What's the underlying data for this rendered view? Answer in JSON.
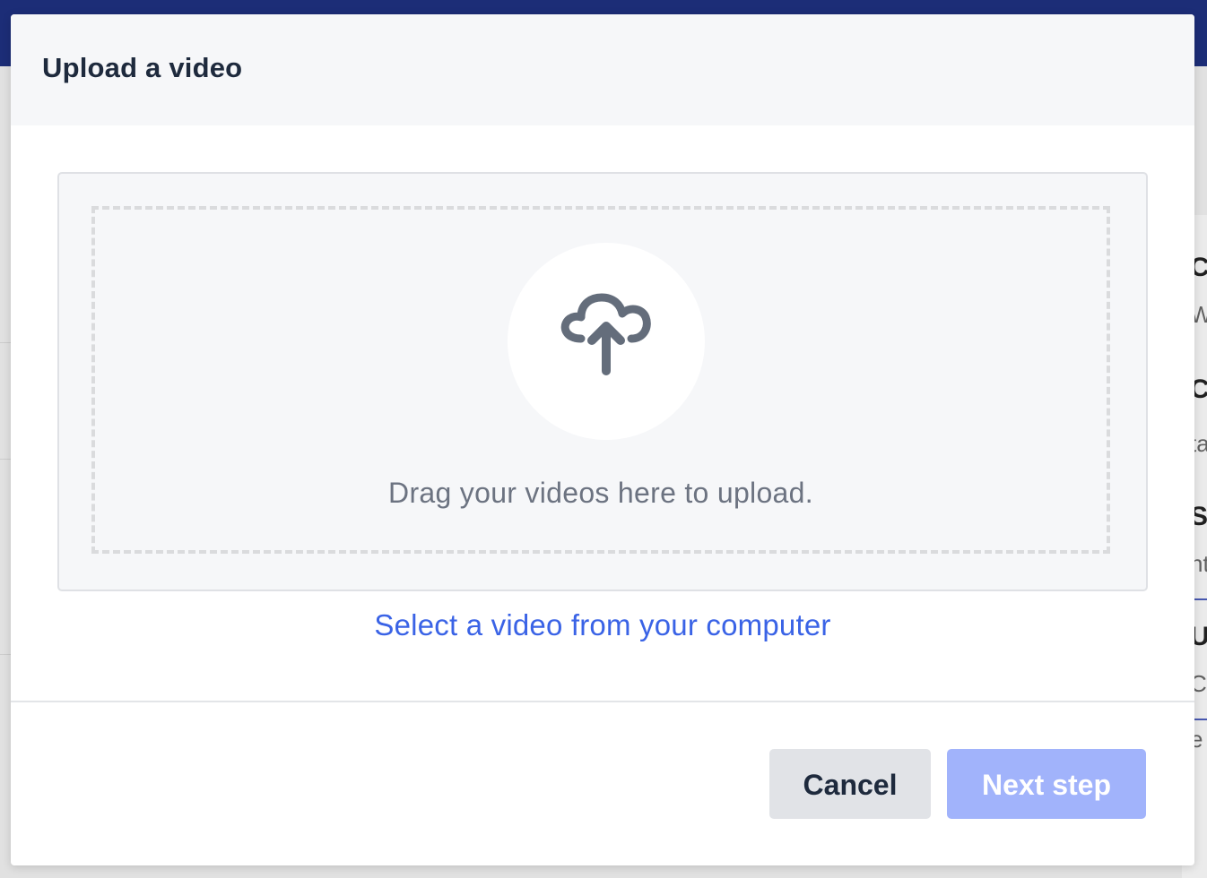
{
  "modal": {
    "title": "Upload a video",
    "dropzone": {
      "icon": "cloud-upload-icon",
      "instruction": "Drag your videos here to upload."
    },
    "select_link": "Select a video from your computer",
    "buttons": {
      "cancel": "Cancel",
      "next": "Next step",
      "next_enabled": false
    }
  },
  "background": {
    "fragments": [
      "Cr",
      "Wr",
      "Cr",
      "ta",
      "Sc",
      "nt",
      "Up",
      "Cl",
      "e"
    ]
  },
  "colors": {
    "topbar": "#1d2f7d",
    "title_text": "#1e2a3d",
    "link": "#3a63e6",
    "next_button_disabled": "#a1b3fb",
    "cancel_button": "#e1e3e7",
    "icon": "#646d7b"
  }
}
